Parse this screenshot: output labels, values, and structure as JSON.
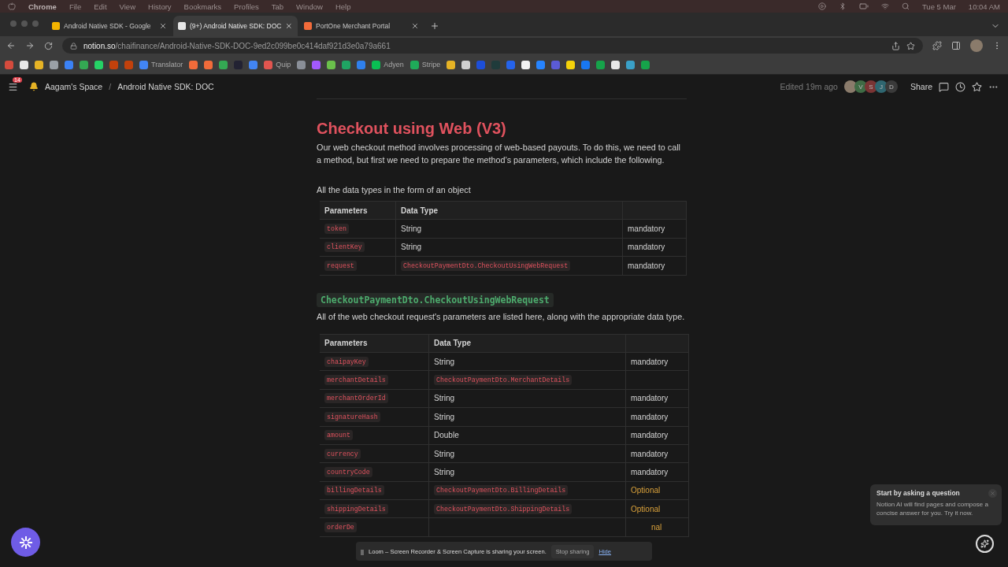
{
  "menu_bar": {
    "app": "Chrome",
    "items": [
      "File",
      "Edit",
      "View",
      "History",
      "Bookmarks",
      "Profiles",
      "Tab",
      "Window",
      "Help"
    ],
    "date": "Tue 5 Mar",
    "time": "10:04 AM"
  },
  "tabs": [
    {
      "title": "Android Native SDK - Google",
      "selected": false
    },
    {
      "title": "(9+) Android Native SDK: DOC",
      "selected": true
    },
    {
      "title": "PortOne Merchant Portal",
      "selected": false
    }
  ],
  "address_bar": {
    "host": "notion.so",
    "path": "/chaifinance/Android-Native-SDK-DOC-9ed2c099be0c414daf921d3e0a79a661"
  },
  "bookmarks": [
    {
      "color": "#d54b3d"
    },
    {
      "color": "#e8e8e8"
    },
    {
      "color": "#e6b325"
    },
    {
      "color": "#9aa0a6"
    },
    {
      "color": "#3b82f6"
    },
    {
      "color": "#34a853"
    },
    {
      "color": "#25d366"
    },
    {
      "color": "#c2410c"
    },
    {
      "color": "#c2410c"
    },
    {
      "color": "#4285f4",
      "label": "Translator"
    },
    {
      "color": "#f26b3a"
    },
    {
      "color": "#f26b3a"
    },
    {
      "color": "#34a853"
    },
    {
      "color": "#222233"
    },
    {
      "color": "#4285f4"
    },
    {
      "color": "#e2554f",
      "label": "Quip"
    },
    {
      "color": "#8a8f98"
    },
    {
      "color": "#a259ff"
    },
    {
      "color": "#6abf4b"
    },
    {
      "color": "#1fa463"
    },
    {
      "color": "#2f80ed"
    },
    {
      "color": "#0abf53",
      "label": "Adyen"
    },
    {
      "color": "#1faa59",
      "label": "Stripe"
    },
    {
      "color": "#e6b325"
    },
    {
      "color": "#d0d0d0"
    },
    {
      "color": "#1d4ed8"
    },
    {
      "color": "#1f3b3b"
    },
    {
      "color": "#2563eb"
    },
    {
      "color": "#f2f2f2"
    },
    {
      "color": "#2684ff"
    },
    {
      "color": "#5b5bd6"
    },
    {
      "color": "#f5d20a"
    },
    {
      "color": "#1877f2"
    },
    {
      "color": "#16a34a"
    },
    {
      "color": "#e8e8e8"
    },
    {
      "color": "#3aa0c8"
    },
    {
      "color": "#16a34a"
    }
  ],
  "notion_bar": {
    "badge": "14",
    "breadcrumbs": [
      "Aagam's Space",
      "Android Native SDK: DOC"
    ],
    "separator": "/",
    "edited": "Edited 19m ago",
    "avatars": [
      {
        "letter": "V",
        "color": "#3f6b45"
      },
      {
        "letter": "S",
        "color": "#7a3434"
      },
      {
        "letter": "J",
        "color": "#2f6670"
      },
      {
        "letter": "D",
        "color": "#3a3a3a"
      }
    ],
    "share": "Share"
  },
  "content": {
    "heading": "Checkout using Web (V3)",
    "intro": "Our web checkout method involves processing of web-based payouts. To do this, we need to call a method, but first we need to prepare the method’s parameters, which include the following.",
    "lead": "All the data types in the form of an object",
    "table_1": {
      "columns": [
        "Parameters",
        "Data Type"
      ],
      "rows": [
        {
          "param": "token",
          "type": "String",
          "kind": "text",
          "required": "mandatory",
          "optional": false
        },
        {
          "param": "clientKey",
          "type": "String",
          "kind": "text",
          "required": "mandatory",
          "optional": false
        },
        {
          "param": "request",
          "type": "CheckoutPaymentDto.CheckoutUsingWebRequest",
          "kind": "code",
          "required": "mandatory",
          "optional": false
        }
      ]
    },
    "code_heading": "CheckoutPaymentDto.CheckoutUsingWebRequest",
    "description": "All of the web checkout request's parameters are listed here, along with the appropriate data type.",
    "table_2": {
      "columns": [
        "Parameters",
        "Data Type"
      ],
      "rows": [
        {
          "param": "chaipayKey",
          "type": "String",
          "kind": "text",
          "required": "mandatory",
          "optional": false
        },
        {
          "param": "merchantDetails",
          "type": "CheckoutPaymentDto.MerchantDetails",
          "kind": "code"
        },
        {
          "param": "merchantOrderId",
          "type": "String",
          "kind": "text",
          "required": "mandatory",
          "optional": false
        },
        {
          "param": "signatureHash",
          "type": "String",
          "kind": "text",
          "required": "mandatory",
          "optional": false
        },
        {
          "param": "amount",
          "type": "Double",
          "kind": "text",
          "required": "mandatory",
          "optional": false
        },
        {
          "param": "currency",
          "type": "String",
          "kind": "text",
          "required": "mandatory",
          "optional": false
        },
        {
          "param": "countryCode",
          "type": "String",
          "kind": "text",
          "required": "mandatory",
          "optional": false
        },
        {
          "param": "billingDetails",
          "type": "CheckoutPaymentDto.BillingDetails",
          "kind": "code",
          "required": "Optional",
          "optional": true
        },
        {
          "param": "shippingDetails",
          "type": "CheckoutPaymentDto.ShippingDetails",
          "kind": "code",
          "required": "Optional",
          "optional": true
        },
        {
          "param": "orderDe",
          "required": "nal",
          "optional": true,
          "covered": true
        }
      ]
    }
  },
  "loom_bar": {
    "pause": "||",
    "message": "Loom – Screen Recorder & Screen Capture is sharing your screen.",
    "stop": "Stop sharing",
    "hide": "Hide"
  },
  "ai_popup": {
    "title": "Start by asking a question",
    "body": "Notion AI will find pages and compose a concise answer for you. Try it now."
  }
}
